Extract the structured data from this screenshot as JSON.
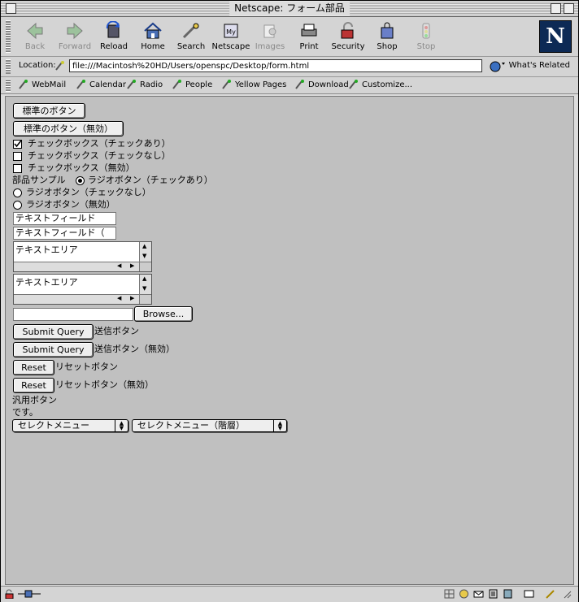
{
  "window": {
    "title": "Netscape: フォーム部品"
  },
  "toolbar": {
    "back": "Back",
    "forward": "Forward",
    "reload": "Reload",
    "home": "Home",
    "search": "Search",
    "netscape": "Netscape",
    "images": "Images",
    "print": "Print",
    "security": "Security",
    "shop": "Shop",
    "stop": "Stop"
  },
  "location": {
    "label": "Location:",
    "url": "file:///Macintosh%20HD/Users/openspc/Desktop/form.html",
    "whats_related": "What's Related"
  },
  "personal_bar": {
    "items": [
      "WebMail",
      "Calendar",
      "Radio",
      "People",
      "Yellow Pages",
      "Download",
      "Customize..."
    ]
  },
  "form": {
    "button_standard": "標準のボタン",
    "button_disabled": "標準のボタン（無効）",
    "checkbox_checked": "チェックボックス（チェックあり）",
    "checkbox_unchecked": "チェックボックス（チェックなし）",
    "checkbox_disabled": "チェックボックス（無効）",
    "parts_sample": "部品サンプル",
    "radio_checked": "ラジオボタン（チェックあり）",
    "radio_unchecked": "ラジオボタン（チェックなし）",
    "radio_disabled": "ラジオボタン（無効）",
    "textfield1_value": "テキストフィールド",
    "textfield2_value": "テキストフィールド（",
    "textarea1_value": "テキストエリア",
    "textarea2_value": "テキストエリア",
    "file_input_value": "",
    "browse_label": "Browse...",
    "submit_label": "Submit Query",
    "submit_caption": "送信ボタン",
    "submit_disabled_caption": "送信ボタン（無効）",
    "reset_label": "Reset",
    "reset_caption": "リセットボタン",
    "reset_disabled_caption": "リセットボタン（無効）",
    "generic_button_line1": "汎用ボタン",
    "generic_button_line2": "です。",
    "select1_value": "セレクトメニュー",
    "select2_value": "セレクトメニュー（階層）"
  },
  "colors": {
    "content_bg": "#c0c0c0",
    "chrome_bg": "#d4d4d4",
    "netscape_logo": "#0d2a55"
  }
}
